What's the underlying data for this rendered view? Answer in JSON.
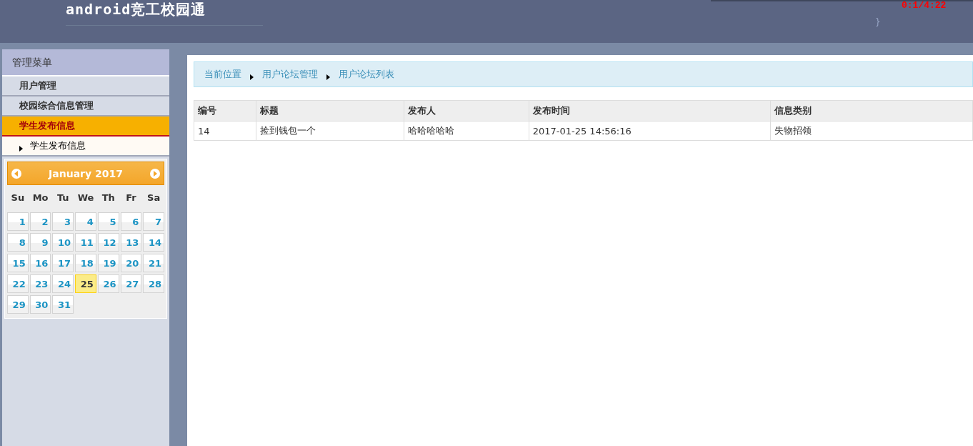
{
  "header": {
    "title": "android竞工校园通",
    "clock": "0:1/4:22",
    "brace": "}"
  },
  "sidebar": {
    "title": "管理菜单",
    "items": [
      {
        "label": "用户管理",
        "selected": false
      },
      {
        "label": "校园综合信息管理",
        "selected": false
      },
      {
        "label": "学生发布信息",
        "selected": true,
        "children": [
          {
            "label": "学生发布信息"
          }
        ]
      }
    ]
  },
  "calendar": {
    "month": "January 2017",
    "weekdays": [
      "Su",
      "Mo",
      "Tu",
      "We",
      "Th",
      "Fr",
      "Sa"
    ],
    "days": [
      {
        "label": "1",
        "selected": false
      },
      {
        "label": "2",
        "selected": false
      },
      {
        "label": "3",
        "selected": false
      },
      {
        "label": "4",
        "selected": false
      },
      {
        "label": "5",
        "selected": false
      },
      {
        "label": "6",
        "selected": false
      },
      {
        "label": "7",
        "selected": false
      },
      {
        "label": "8",
        "selected": false
      },
      {
        "label": "9",
        "selected": false
      },
      {
        "label": "10",
        "selected": false
      },
      {
        "label": "11",
        "selected": false
      },
      {
        "label": "12",
        "selected": false
      },
      {
        "label": "13",
        "selected": false
      },
      {
        "label": "14",
        "selected": false
      },
      {
        "label": "15",
        "selected": false
      },
      {
        "label": "16",
        "selected": false
      },
      {
        "label": "17",
        "selected": false
      },
      {
        "label": "18",
        "selected": false
      },
      {
        "label": "19",
        "selected": false
      },
      {
        "label": "20",
        "selected": false
      },
      {
        "label": "21",
        "selected": false
      },
      {
        "label": "22",
        "selected": false
      },
      {
        "label": "23",
        "selected": false
      },
      {
        "label": "24",
        "selected": false
      },
      {
        "label": "25",
        "selected": true
      },
      {
        "label": "26",
        "selected": false
      },
      {
        "label": "27",
        "selected": false
      },
      {
        "label": "28",
        "selected": false
      },
      {
        "label": "29",
        "selected": false
      },
      {
        "label": "30",
        "selected": false
      },
      {
        "label": "31",
        "selected": false
      }
    ]
  },
  "breadcrumb": [
    "当前位置",
    "用户论坛管理",
    "用户论坛列表"
  ],
  "table": {
    "columns": [
      "编号",
      "标题",
      "发布人",
      "发布时间",
      "信息类别"
    ],
    "rows": [
      [
        "14",
        "捡到钱包一个",
        "哈哈哈哈哈",
        "2017-01-25 14:56:16",
        "失物招领"
      ]
    ]
  }
}
